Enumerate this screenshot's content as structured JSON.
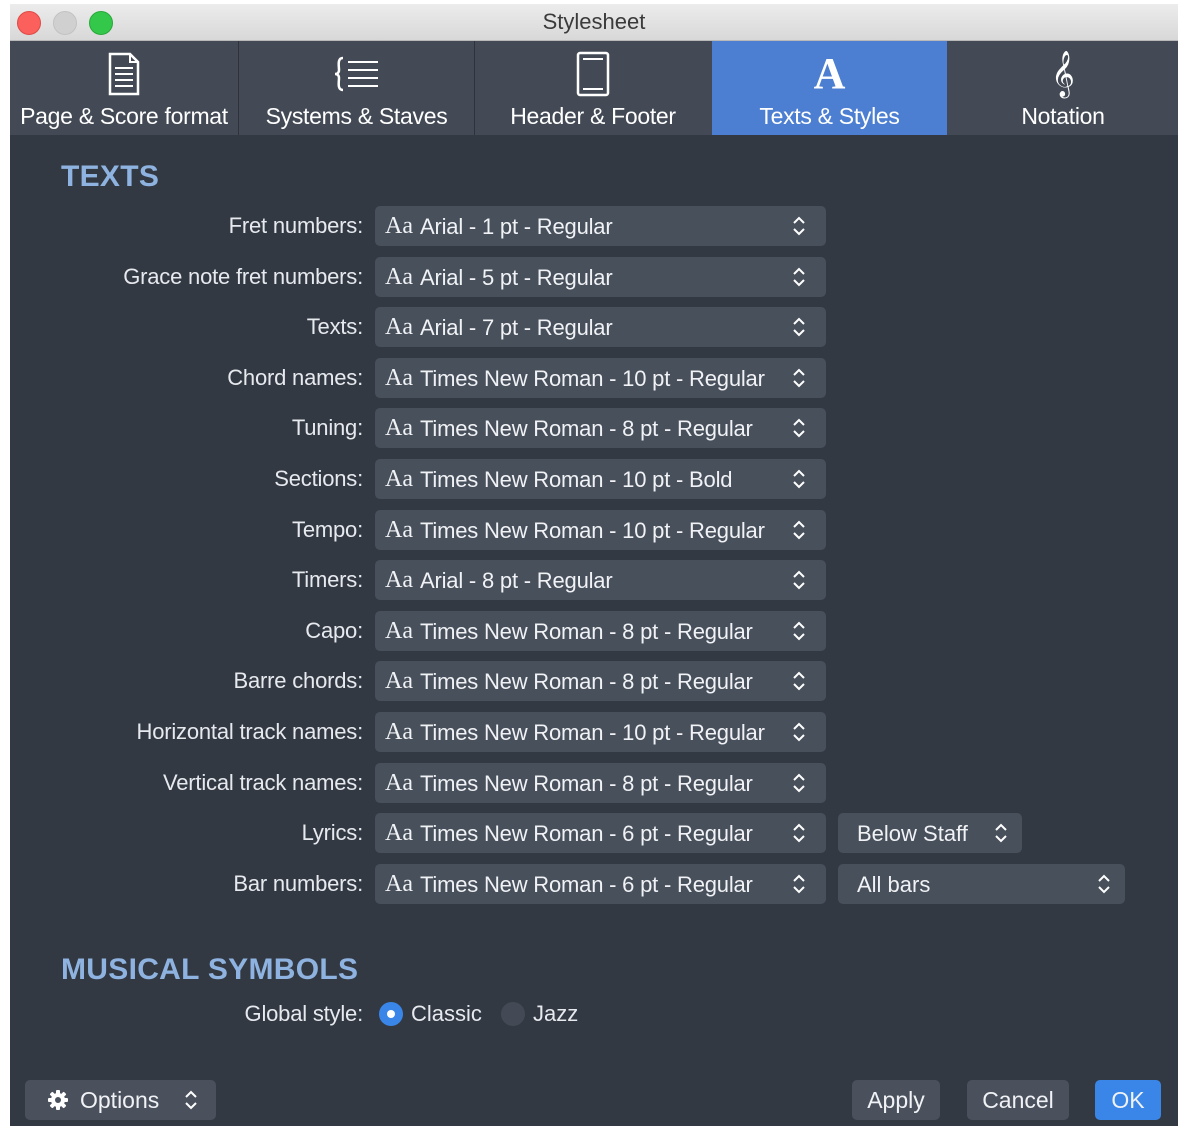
{
  "window": {
    "title": "Stylesheet"
  },
  "tabs": [
    {
      "label": "Page & Score format",
      "icon": "page-icon",
      "active": false
    },
    {
      "label": "Systems & Staves",
      "icon": "systems-staves-icon",
      "active": false
    },
    {
      "label": "Header & Footer",
      "icon": "header-footer-icon",
      "active": false
    },
    {
      "label": "Texts & Styles",
      "icon": "text-style-icon",
      "active": true
    },
    {
      "label": "Notation",
      "icon": "treble-clef-icon",
      "active": false
    }
  ],
  "texts": {
    "title": "TEXTS",
    "aa": "Aa",
    "rows": [
      {
        "label": "Fret numbers:",
        "value": "Arial - 1 pt - Regular"
      },
      {
        "label": "Grace note fret numbers:",
        "value": "Arial - 5 pt - Regular"
      },
      {
        "label": "Texts:",
        "value": "Arial - 7 pt - Regular"
      },
      {
        "label": "Chord names:",
        "value": "Times New Roman - 10 pt - Regular"
      },
      {
        "label": "Tuning:",
        "value": "Times New Roman - 8 pt - Regular"
      },
      {
        "label": "Sections:",
        "value": "Times New Roman - 10 pt - Bold"
      },
      {
        "label": "Tempo:",
        "value": "Times New Roman - 10 pt - Regular"
      },
      {
        "label": "Timers:",
        "value": "Arial - 8 pt - Regular"
      },
      {
        "label": "Capo:",
        "value": "Times New Roman - 8 pt - Regular"
      },
      {
        "label": "Barre chords:",
        "value": "Times New Roman - 8 pt - Regular"
      },
      {
        "label": "Horizontal track names:",
        "value": "Times New Roman - 10 pt - Regular"
      },
      {
        "label": "Vertical track names:",
        "value": "Times New Roman - 8 pt - Regular"
      },
      {
        "label": "Lyrics:",
        "value": "Times New Roman - 6 pt - Regular"
      },
      {
        "label": "Bar numbers:",
        "value": "Times New Roman - 6 pt - Regular"
      }
    ],
    "lyrics_position": "Below Staff",
    "bar_numbers_mode": "All bars"
  },
  "musical_symbols": {
    "title": "MUSICAL SYMBOLS",
    "global_style_label": "Global style:",
    "options": [
      {
        "label": "Classic",
        "selected": true
      },
      {
        "label": "Jazz",
        "selected": false
      }
    ]
  },
  "footer": {
    "options_label": "Options",
    "apply_label": "Apply",
    "cancel_label": "Cancel",
    "ok_label": "OK"
  },
  "colors": {
    "background": "#333943",
    "tab_bar": "#434a55",
    "active_tab": "#4c7fd1",
    "section_title": "#8fb3e0",
    "control": "#48505c",
    "accent": "#3a86e8",
    "close": "#fc605c",
    "minimize_inactive": "#d0d0d0",
    "zoom": "#34c84a"
  }
}
